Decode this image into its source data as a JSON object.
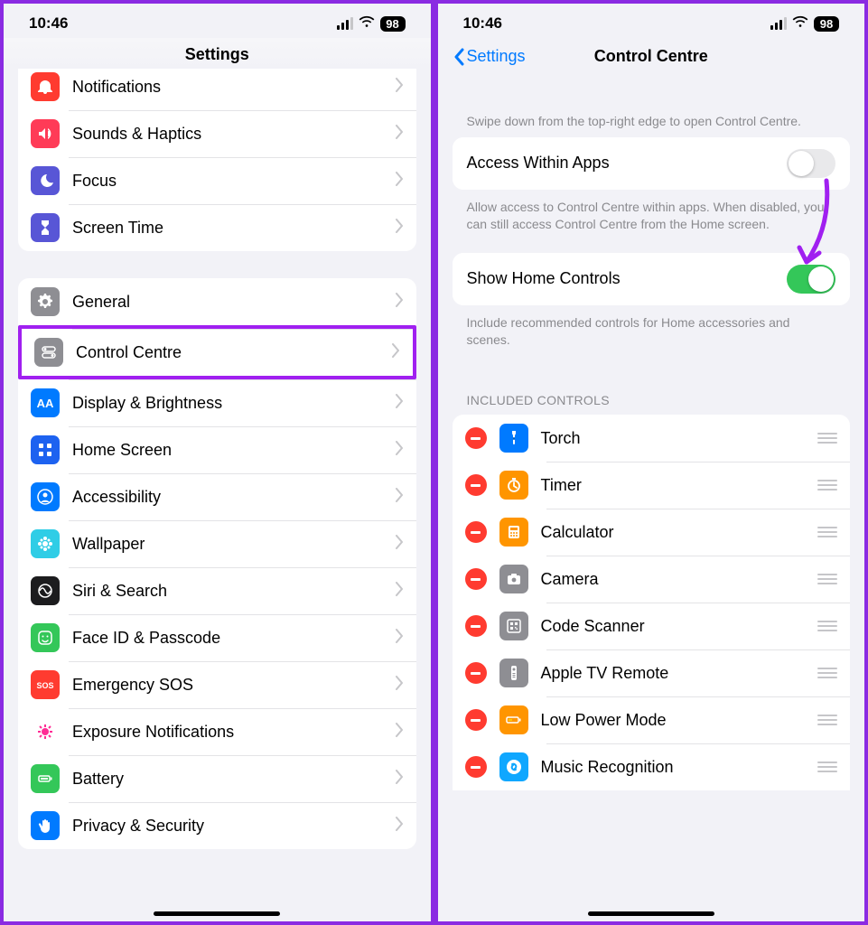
{
  "status": {
    "time": "10:46",
    "battery": "98"
  },
  "left": {
    "title": "Settings",
    "rows_top": [
      {
        "id": "notifications",
        "label": "Notifications",
        "color": "bg-red",
        "icon": "bell"
      },
      {
        "id": "sounds",
        "label": "Sounds & Haptics",
        "color": "bg-pink",
        "icon": "speaker"
      },
      {
        "id": "focus",
        "label": "Focus",
        "color": "bg-purple",
        "icon": "moon"
      },
      {
        "id": "screentime",
        "label": "Screen Time",
        "color": "bg-purple",
        "icon": "hourglass"
      }
    ],
    "rows_mid": [
      {
        "id": "general",
        "label": "General",
        "color": "bg-grey",
        "icon": "gear"
      },
      {
        "id": "controlcentre",
        "label": "Control Centre",
        "color": "bg-grey",
        "icon": "toggles",
        "highlight": true
      },
      {
        "id": "display",
        "label": "Display & Brightness",
        "color": "bg-blue",
        "icon": "aa"
      },
      {
        "id": "homescreen",
        "label": "Home Screen",
        "color": "bg-deepblue",
        "icon": "grid"
      },
      {
        "id": "accessibility",
        "label": "Accessibility",
        "color": "bg-blue",
        "icon": "person"
      },
      {
        "id": "wallpaper",
        "label": "Wallpaper",
        "color": "bg-cyan",
        "icon": "flower"
      },
      {
        "id": "siri",
        "label": "Siri & Search",
        "color": "bg-black",
        "icon": "siri"
      },
      {
        "id": "faceid",
        "label": "Face ID & Passcode",
        "color": "bg-green",
        "icon": "face"
      },
      {
        "id": "sos",
        "label": "Emergency SOS",
        "color": "bg-sos",
        "icon": "sos"
      },
      {
        "id": "exposure",
        "label": "Exposure Notifications",
        "color": "",
        "icon": "covid"
      },
      {
        "id": "battery",
        "label": "Battery",
        "color": "bg-green",
        "icon": "battery"
      },
      {
        "id": "privacy",
        "label": "Privacy & Security",
        "color": "bg-blue",
        "icon": "hand"
      }
    ]
  },
  "right": {
    "back": "Settings",
    "title": "Control Centre",
    "hint1": "Swipe down from the top-right edge to open Control Centre.",
    "toggle1": {
      "label": "Access Within Apps",
      "on": false
    },
    "hint2": "Allow access to Control Centre within apps. When disabled, you can still access Control Centre from the Home screen.",
    "toggle2": {
      "label": "Show Home Controls",
      "on": true
    },
    "hint3": "Include recommended controls for Home accessories and scenes.",
    "included_header": "INCLUDED CONTROLS",
    "controls": [
      {
        "id": "torch",
        "label": "Torch",
        "color": "bg-blue",
        "icon": "torch"
      },
      {
        "id": "timer",
        "label": "Timer",
        "color": "bg-orange",
        "icon": "timer"
      },
      {
        "id": "calculator",
        "label": "Calculator",
        "color": "bg-orange",
        "icon": "calc"
      },
      {
        "id": "camera",
        "label": "Camera",
        "color": "bg-grey",
        "icon": "camera"
      },
      {
        "id": "codescanner",
        "label": "Code Scanner",
        "color": "bg-grey",
        "icon": "qr"
      },
      {
        "id": "appletv",
        "label": "Apple TV Remote",
        "color": "bg-grey",
        "icon": "remote"
      },
      {
        "id": "lowpower",
        "label": "Low Power Mode",
        "color": "bg-orange",
        "icon": "lowpower"
      },
      {
        "id": "music",
        "label": "Music Recognition",
        "color": "bg-shazam",
        "icon": "shazam"
      }
    ]
  }
}
